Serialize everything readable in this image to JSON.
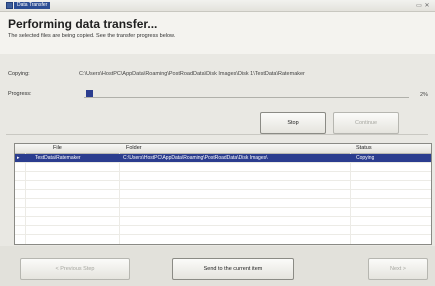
{
  "window": {
    "title": "Data Transfer",
    "controls": "▭ ✕"
  },
  "header": {
    "title": "Performing data transfer...",
    "subtitle": "The selected files are being copied. See the transfer progress below."
  },
  "copying": {
    "label": "Copying:",
    "path": "C:\\Users\\HostPC\\AppData\\Roaming\\PostRoadData\\Disk Images\\Disk 1\\TestData\\Ratemaker"
  },
  "progress": {
    "label": "Progress:",
    "value_percent": 2,
    "text": "2%"
  },
  "buttons": {
    "stop": "Stop",
    "continue": "Continue",
    "previous": "< Previous Step",
    "details": "Send to the current item",
    "next": "Next >"
  },
  "table": {
    "columns": [
      "File",
      "Folder",
      "Status"
    ],
    "rows": [
      {
        "marker": "▸",
        "file": "TestData\\Ratemaker",
        "folder": "C:\\Users\\HostPC\\AppData\\Roaming\\PostRoadData\\Disk Images\\",
        "status": "Copying"
      }
    ]
  }
}
